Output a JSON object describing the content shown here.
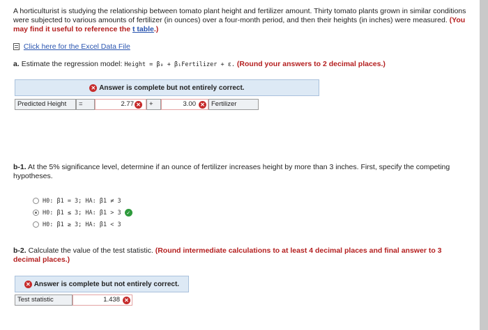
{
  "intro": {
    "text": "A horticulturist is studying the relationship between tomato plant height and fertilizer amount. Thirty tomato plants grown in similar conditions were subjected to various amounts of fertilizer (in ounces) over a four-month period, and then their heights (in inches) were measured.",
    "hint": "(You may find it useful to reference the",
    "hint_link": "t table",
    "hint_end": ".)"
  },
  "excel_link": "Click here for the Excel Data File",
  "part_a": {
    "label": "a.",
    "text": "Estimate the regression model:",
    "formula": "Height = β₀ + β₁Fertilizer + ε.",
    "instruction": "(Round your answers to 2 decimal places.)",
    "banner": "Answer is complete but not entirely correct.",
    "row": {
      "label": "Predicted Height",
      "eq": "=",
      "intercept": "2.77",
      "plus": "+",
      "slope": "3.00",
      "var": "Fertilizer"
    }
  },
  "part_b1": {
    "label": "b-1.",
    "text": "At the 5% significance level, determine if an ounce of fertilizer increases height by more than 3 inches. First, specify the competing hypotheses.",
    "options": [
      {
        "text": "H0: β1 = 3; HA: β1 ≠ 3",
        "selected": false
      },
      {
        "text": "H0: β1 ≤ 3; HA: β1 > 3",
        "selected": true
      },
      {
        "text": "H0: β1 ≥ 3; HA: β1 < 3",
        "selected": false
      }
    ]
  },
  "part_b2": {
    "label": "b-2.",
    "text": "Calculate the value of the test statistic.",
    "instruction": "(Round intermediate calculations to at least 4 decimal places and final answer to 3 decimal places.)",
    "banner": "Answer is complete but not entirely correct.",
    "row": {
      "label": "Test statistic",
      "value": "1.438"
    }
  }
}
